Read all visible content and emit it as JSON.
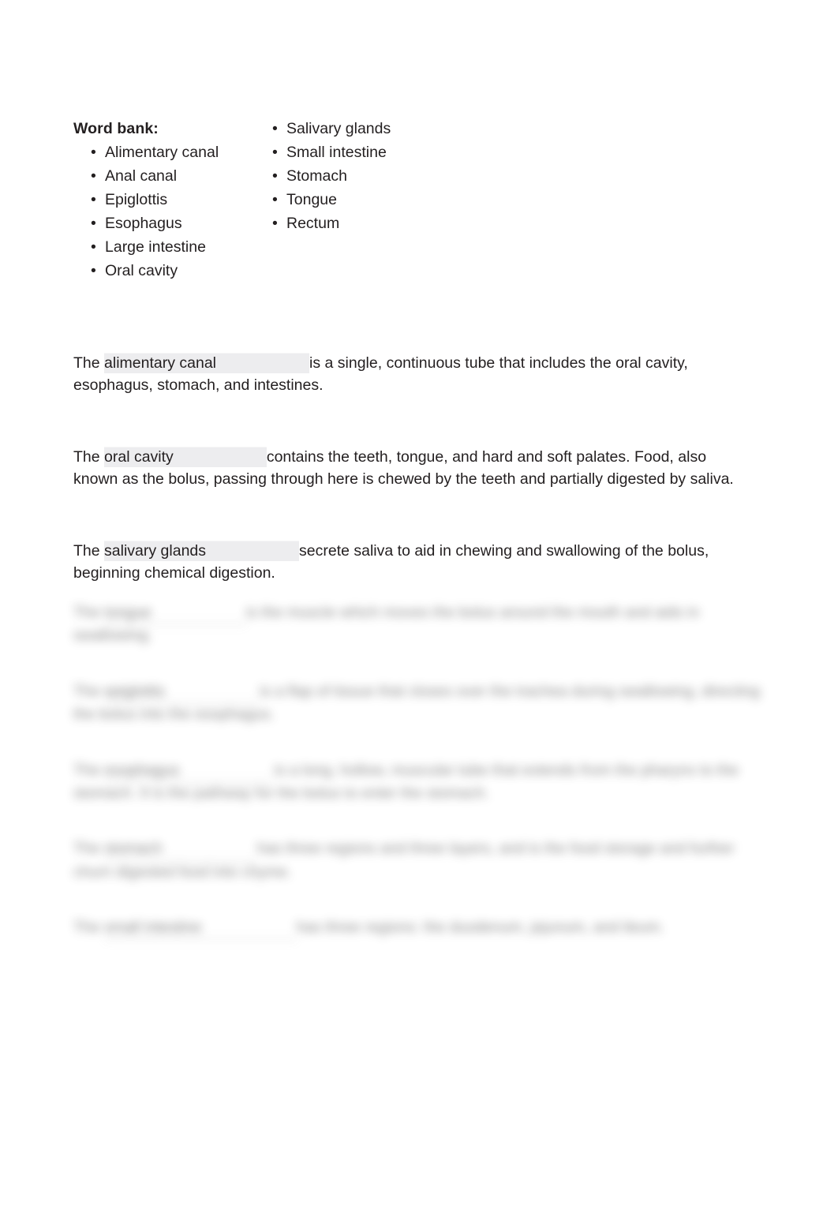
{
  "document": {
    "page_background": "#ffffff",
    "text_color": "#231f20",
    "blank_highlight_color": "#ececee"
  },
  "word_bank": {
    "title": "Word bank:",
    "bullet_glyph": "•",
    "column_1": [
      "Alimentary canal",
      "Anal canal",
      "Epiglottis",
      "Esophagus",
      "Large intestine",
      "Oral cavity"
    ],
    "column_2": [
      "Salivary glands",
      "Small intestine",
      "Stomach",
      "Tongue",
      "Rectum"
    ]
  },
  "answers": [
    {
      "lead": "The ",
      "answer": "alimentary canal",
      "rest": "is a single, continuous tube that includes the oral cavity, esophagus, stomach, and intestines."
    },
    {
      "lead": "The ",
      "answer": "oral cavity",
      "rest": "contains the teeth, tongue, and hard and soft palates. Food, also known as the bolus, passing through here is chewed by the teeth and partially digested by saliva."
    },
    {
      "lead": "The ",
      "answer": "salivary glands",
      "rest": "secrete saliva to aid in chewing and swallowing of the bolus, beginning chemical digestion."
    }
  ],
  "blurred_answers": [
    {
      "lead": "The ",
      "answer": "tongue",
      "rest": "is the muscle which moves the bolus around the mouth and aids in swallowing."
    },
    {
      "lead": "The ",
      "answer": "epiglottis",
      "rest": "is a flap of tissue that closes over the trachea during swallowing, directing the bolus into the esophagus."
    },
    {
      "lead": "The ",
      "answer": "esophagus",
      "rest": "is a long, hollow, muscular tube that extends from the pharynx to the stomach. It is the pathway for the bolus to enter the stomach."
    },
    {
      "lead": "The ",
      "answer": "stomach",
      "rest": "has three regions and three layers, and is the food storage and further churn digested food into chyme."
    },
    {
      "lead": "The ",
      "answer": "small intestine",
      "rest": "has three regions: the duodenum, jejunum, and ileum."
    }
  ]
}
